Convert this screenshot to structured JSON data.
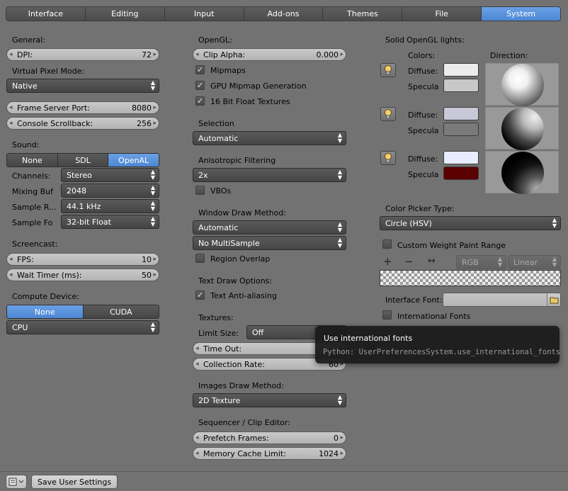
{
  "tabs": [
    "Interface",
    "Editing",
    "Input",
    "Add-ons",
    "Themes",
    "File",
    "System"
  ],
  "active_tab": "System",
  "left": {
    "general_heading": "General:",
    "dpi": {
      "label": "DPI:",
      "value": "72"
    },
    "vpm_heading": "Virtual Pixel Mode:",
    "vpm_value": "Native",
    "frame_server_port": {
      "label": "Frame Server Port:",
      "value": "8080"
    },
    "console_scrollback": {
      "label": "Console Scrollback:",
      "value": "256"
    },
    "sound_heading": "Sound:",
    "sound_options": [
      "None",
      "SDL",
      "OpenAL"
    ],
    "sound_selected": "OpenAL",
    "channels": {
      "label": "Channels:",
      "value": "Stereo"
    },
    "mixing_buf": {
      "label": "Mixing Buf",
      "value": "2048"
    },
    "sample_rate": {
      "label": "Sample R...",
      "value": "44.1 kHz"
    },
    "sample_fo": {
      "label": "Sample Fo",
      "value": "32-bit Float"
    },
    "screencast_heading": "Screencast:",
    "fps": {
      "label": "FPS:",
      "value": "10"
    },
    "wait_timer": {
      "label": "Wait Timer (ms):",
      "value": "50"
    },
    "compute_heading": "Compute Device:",
    "compute_options": [
      "None",
      "CUDA"
    ],
    "compute_selected": "None",
    "compute_device": "CPU"
  },
  "middle": {
    "opengl_heading": "OpenGL:",
    "clip_alpha": {
      "label": "Clip Alpha:",
      "value": "0.000"
    },
    "mipmaps": "Mipmaps",
    "gpu_mipmap": "GPU Mipmap Generation",
    "float_textures": "16 Bit Float Textures",
    "selection_heading": "Selection",
    "selection_value": "Automatic",
    "aniso_heading": "Anisotropic Filtering",
    "aniso_value": "2x",
    "vbos": "VBOs",
    "wdm_heading": "Window Draw Method:",
    "wdm_value": "Automatic",
    "multisample_value": "No MultiSample",
    "region_overlap": "Region Overlap",
    "text_draw_heading": "Text Draw Options:",
    "text_aa": "Text Anti-aliasing",
    "textures_heading": "Textures:",
    "limit_size": {
      "label": "Limit Size:",
      "value": "Off"
    },
    "time_out": {
      "label": "Time Out:",
      "value": ""
    },
    "collection_rate": {
      "label": "Collection Rate:",
      "value": "60"
    },
    "images_heading": "Images Draw Method:",
    "images_value": "2D Texture",
    "seq_heading": "Sequencer / Clip Editor:",
    "prefetch": {
      "label": "Prefetch Frames:",
      "value": "0"
    },
    "mem_cache": {
      "label": "Memory Cache Limit:",
      "value": "1024"
    }
  },
  "right": {
    "lights_heading": "Solid OpenGL lights:",
    "colors_heading": "Colors:",
    "direction_heading": "Direction:",
    "diffuse_label": "Diffuse:",
    "specular_label": "Specula",
    "lights": [
      {
        "diffuse": "#ececec",
        "specular": "#c8c8c8"
      },
      {
        "diffuse": "#c8c8d8",
        "specular": "#7a7a7a"
      },
      {
        "diffuse": "#e8ecff",
        "specular": "#5a0000"
      }
    ],
    "color_picker_heading": "Color Picker Type:",
    "color_picker_value": "Circle (HSV)",
    "custom_weight": "Custom Weight Paint Range",
    "ramp_color_mode": "RGB",
    "ramp_interp": "Linear",
    "interface_font_label": "Interface Font:",
    "international_fonts": "International Fonts"
  },
  "tooltip": {
    "title": "Use international fonts",
    "python": "Python: UserPreferencesSystem.use_international_fonts"
  },
  "footer": {
    "save_label": "Save User Settings"
  },
  "colors": {
    "accent": "#5a92dc",
    "panel_bg": "#727272"
  }
}
